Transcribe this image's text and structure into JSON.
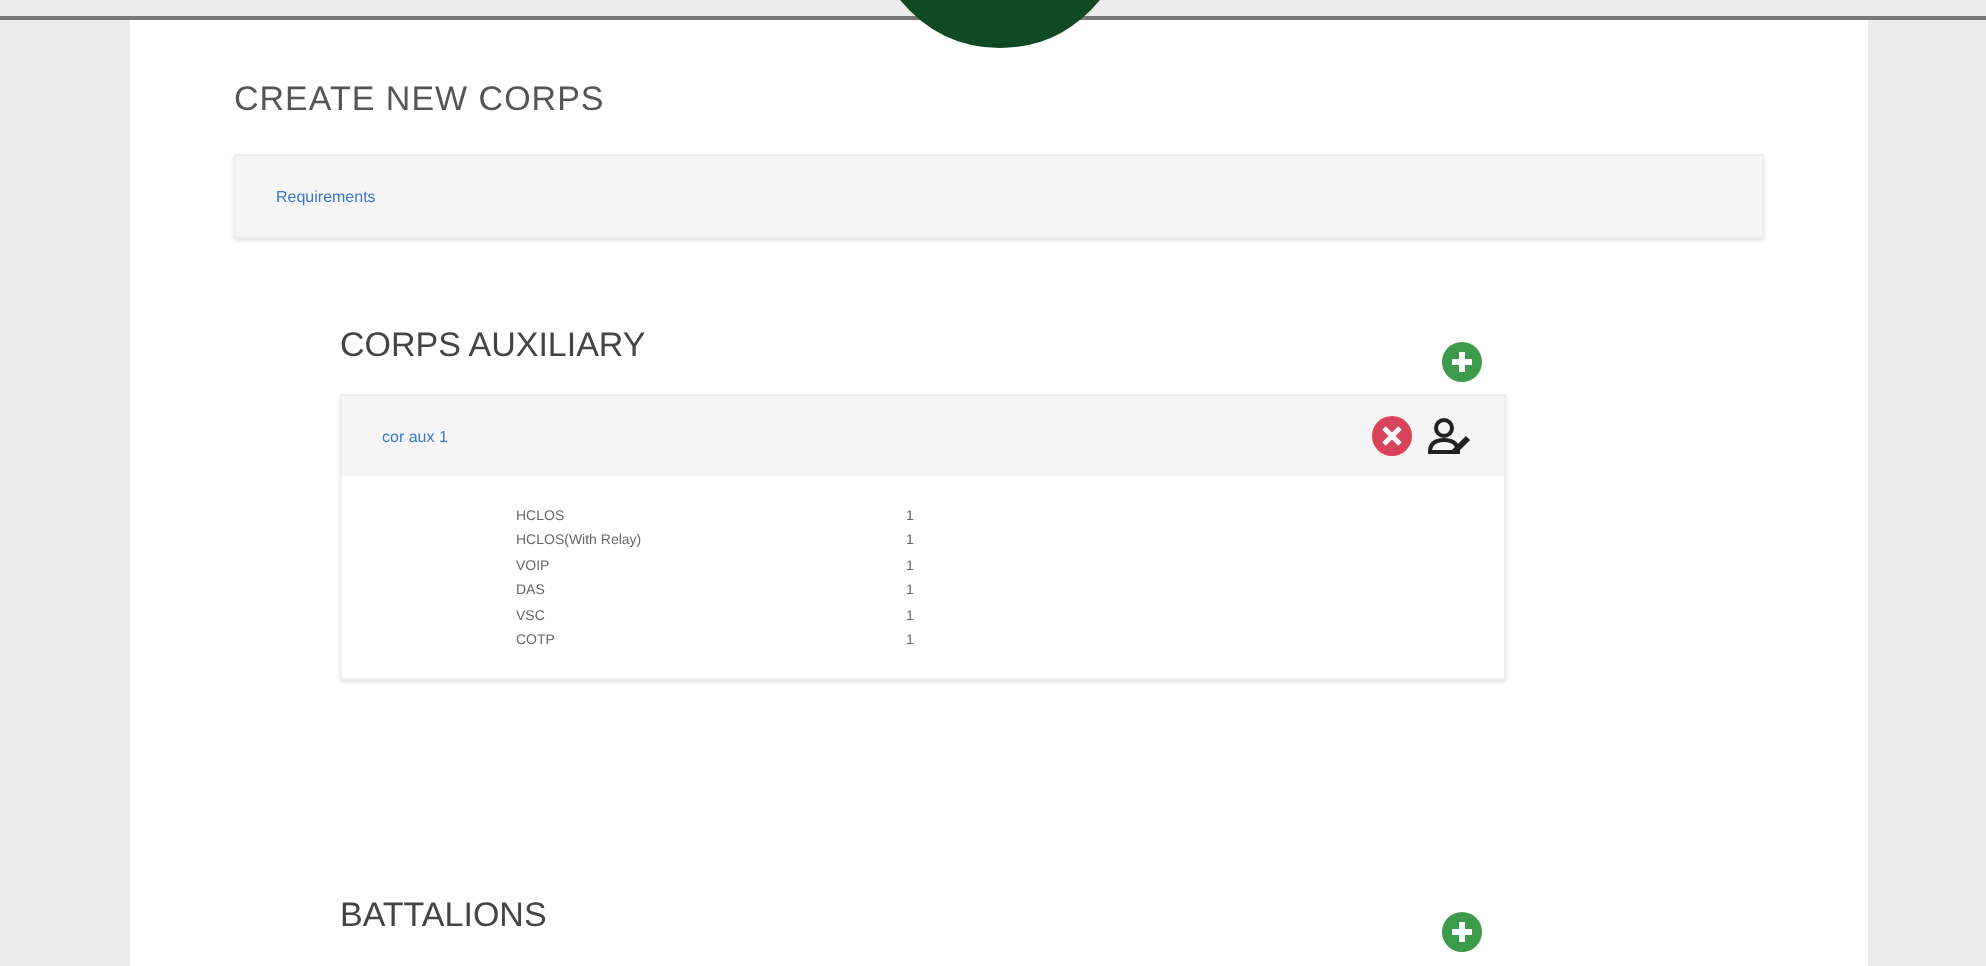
{
  "page_title": "CREATE NEW CORPS",
  "requirements_link": "Requirements",
  "sections": [
    {
      "title": "CORPS AUXILIARY",
      "cards": [
        {
          "name": "cor aux 1",
          "rows": [
            {
              "label": "HCLOS",
              "value": "1"
            },
            {
              "label": "HCLOS(With Relay)",
              "value": "1"
            },
            {
              "label": "VOIP",
              "value": "1"
            },
            {
              "label": "DAS",
              "value": "1"
            },
            {
              "label": "VSC",
              "value": "1"
            },
            {
              "label": "COTP",
              "value": "1"
            }
          ]
        }
      ]
    },
    {
      "title": "BATTALIONS"
    }
  ]
}
